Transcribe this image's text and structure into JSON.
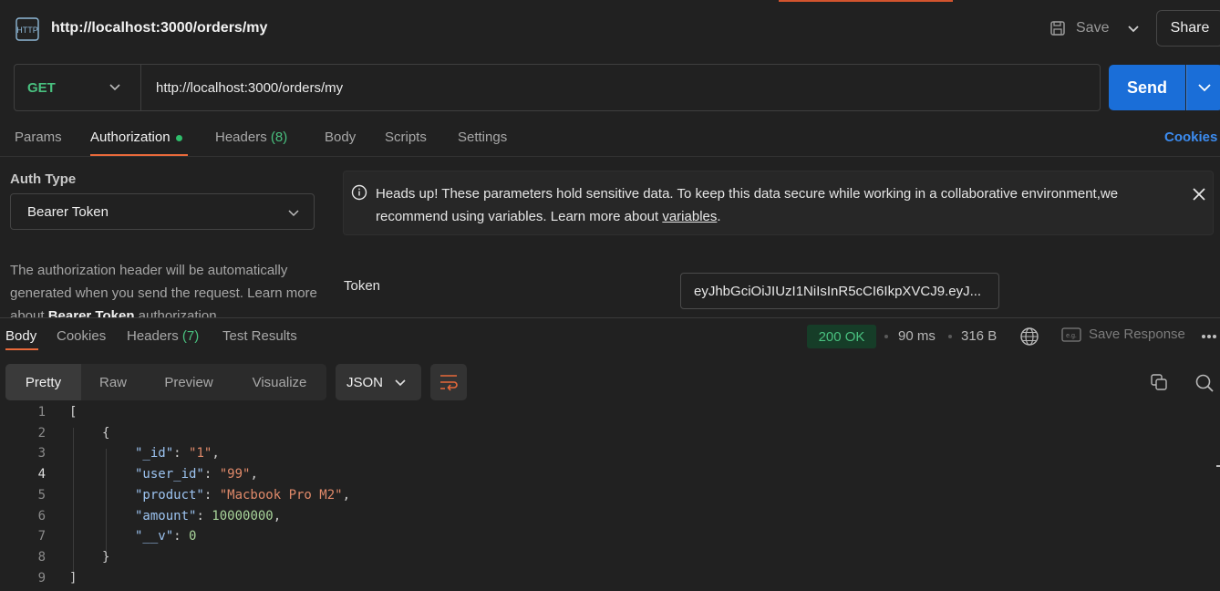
{
  "header": {
    "title": "http://localhost:3000/orders/my",
    "save_label": "Save",
    "share_label": "Share"
  },
  "request": {
    "method": "GET",
    "url": "http://localhost:3000/orders/my",
    "send_label": "Send"
  },
  "req_tabs": {
    "params": "Params",
    "authorization": "Authorization",
    "headers": "Headers",
    "headers_count": "(8)",
    "body": "Body",
    "scripts": "Scripts",
    "settings": "Settings",
    "cookies": "Cookies"
  },
  "auth": {
    "type_label": "Auth Type",
    "type_value": "Bearer Token",
    "desc_pre": "The authorization header will be automatically generated when you send the request. Learn more about ",
    "desc_bold": "Bearer Token",
    "desc_post": " authorization.",
    "notice_text": "Heads up! These parameters hold sensitive data. To keep this data secure while working in a collaborative environment,we recommend using variables. Learn more about ",
    "notice_link": "variables",
    "notice_end": ".",
    "token_label": "Token",
    "token_value": "eyJhbGciOiJIUzI1NiIsInR5cCI6IkpXVCJ9.eyJ..."
  },
  "response": {
    "tabs": {
      "body": "Body",
      "cookies": "Cookies",
      "headers": "Headers",
      "headers_count": "(7)",
      "test_results": "Test Results"
    },
    "status": "200 OK",
    "time": "90 ms",
    "size": "316 B",
    "save_response": "Save Response",
    "views": [
      "Pretty",
      "Raw",
      "Preview",
      "Visualize"
    ],
    "format": "JSON"
  },
  "code": {
    "line_numbers": [
      "1",
      "2",
      "3",
      "4",
      "5",
      "6",
      "7",
      "8",
      "9"
    ],
    "open_array": "[",
    "open_obj": "{",
    "k_id": "\"_id\"",
    "v_id": "\"1\"",
    "k_user": "\"user_id\"",
    "v_user": "\"99\"",
    "k_product": "\"product\"",
    "v_product": "\"Macbook Pro M2\"",
    "k_amount": "\"amount\"",
    "v_amount": "10000000",
    "k_v": "\"__v\"",
    "v_v": "0",
    "close_obj": "}",
    "close_array": "]"
  },
  "colors": {
    "accent": "#e8693a",
    "send": "#1a6ed8",
    "method": "#49c07f",
    "link": "#3c8cf0"
  }
}
